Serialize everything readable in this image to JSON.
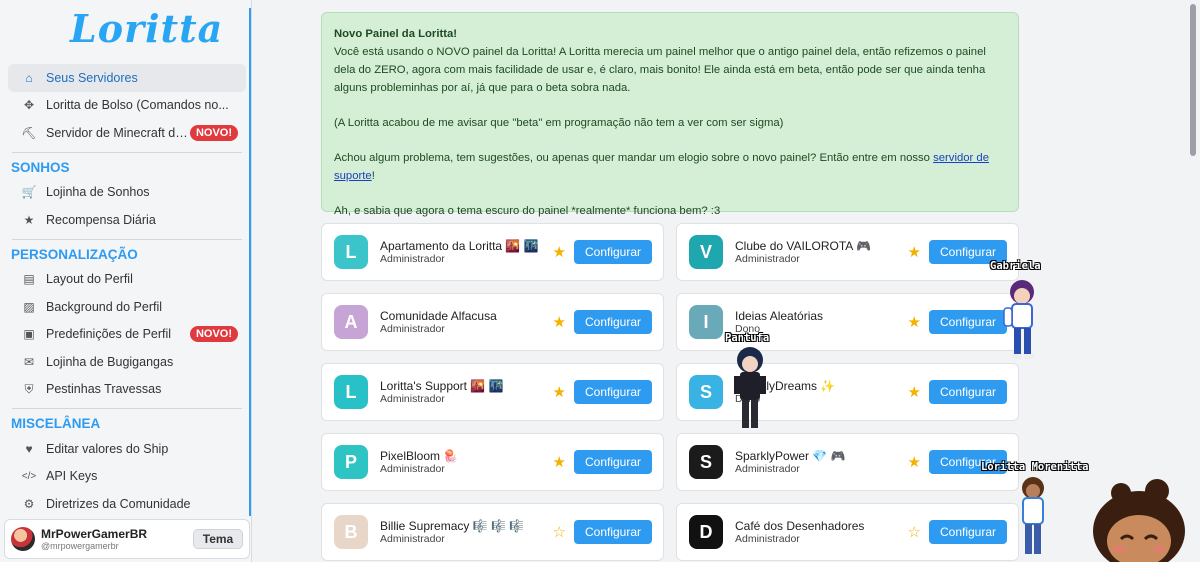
{
  "sidebar": {
    "logo": "Loritta",
    "top_items": [
      {
        "label": "Seus Servidores",
        "icon": "home-icon"
      },
      {
        "label": "Loritta de Bolso (Comandos no...",
        "icon": "puzzle-icon"
      },
      {
        "label": "Servidor de Minecraft da...",
        "icon": "pickaxe-icon",
        "badge": "NOVO!"
      }
    ],
    "sections": [
      {
        "title": "SONHOS",
        "items": [
          {
            "label": "Lojinha de Sonhos",
            "icon": "cart-icon"
          },
          {
            "label": "Recompensa Diária",
            "icon": "star-icon"
          }
        ]
      },
      {
        "title": "PERSONALIZAÇÃO",
        "items": [
          {
            "label": "Layout do Perfil",
            "icon": "id-card-icon"
          },
          {
            "label": "Background do Perfil",
            "icon": "image-icon"
          },
          {
            "label": "Predefinições de Perfil",
            "icon": "preset-icon",
            "badge": "NOVO!"
          },
          {
            "label": "Lojinha de Bugigangas",
            "icon": "mail-icon"
          },
          {
            "label": "Pestinhas Travessas",
            "icon": "shield-icon"
          }
        ]
      },
      {
        "title": "MISCELÂNEA",
        "items": [
          {
            "label": "Editar valores do Ship",
            "icon": "heart-icon"
          },
          {
            "label": "API Keys",
            "icon": "code-icon"
          },
          {
            "label": "Diretrizes da Comunidade",
            "icon": "policy-icon"
          }
        ]
      }
    ],
    "user": {
      "name": "MrPowerGamerBR",
      "handle": "@mrpowergamerbr",
      "theme_button": "Tema"
    }
  },
  "notice": {
    "title": "Novo Painel da Loritta!",
    "p1": "Você está usando o NOVO painel da Loritta! A Loritta merecia um painel melhor que o antigo painel dela, então refizemos o painel dela do ZERO, agora com mais facilidade de usar e, é claro, mais bonito! Ele ainda está em beta, então pode ser que ainda tenha alguns probleminhas por aí, já que para o beta sobra nada.",
    "p2": "(A Loritta acabou de me avisar que \"beta\" em programação não tem a ver com ser sigma)",
    "p3_before": "Achou algum problema, tem sugestões, ou apenas quer mandar um elogio sobre o novo painel? Então entre em nosso ",
    "p3_link": "servidor de suporte",
    "p3_after": "!",
    "p4": "Ah, e sabia que agora o tema escuro do painel *realmente* funciona bem? :3"
  },
  "configure_label": "Configurar",
  "servers": [
    {
      "name": "Apartamento da Loritta 🌇 🌃",
      "role": "Administrador",
      "favorite": true,
      "icon_color": "#3bc4c9",
      "initial": "L"
    },
    {
      "name": "Clube do VAILOROTA 🎮",
      "role": "Administrador",
      "favorite": true,
      "icon_color": "#1fa7b0",
      "initial": "V"
    },
    {
      "name": "Comunidade Alfacusa",
      "role": "Administrador",
      "favorite": true,
      "icon_color": "#c6a4d6",
      "initial": "A"
    },
    {
      "name": "Ideias Aleatórias",
      "role": "Dono",
      "favorite": true,
      "icon_color": "#6aa9b8",
      "initial": "I"
    },
    {
      "name": "Loritta's Support 🌇 🌃",
      "role": "Administrador",
      "favorite": true,
      "icon_color": "#29c1c8",
      "initial": "L"
    },
    {
      "name": "SparklyDreams ✨",
      "role": "Dono",
      "favorite": true,
      "icon_color": "#39b3e3",
      "initial": "S"
    },
    {
      "name": "PixelBloom 🪼",
      "role": "Administrador",
      "favorite": true,
      "icon_color": "#2fc4c4",
      "initial": "P"
    },
    {
      "name": "SparklyPower 💎 🎮",
      "role": "Administrador",
      "favorite": true,
      "icon_color": "#1b1b1b",
      "initial": "S"
    },
    {
      "name": "Billie Supremacy 🎼 🎼 🎼",
      "role": "Administrador",
      "favorite": false,
      "icon_color": "#e8d6c8",
      "initial": "B"
    },
    {
      "name": "Café dos Desenhadores",
      "role": "Administrador",
      "favorite": false,
      "icon_color": "#111111",
      "initial": "D"
    }
  ],
  "characters": {
    "gabriela": "Gabriela",
    "pantufa": "Pantufa",
    "loritta_morenitta": "Loritta Morenitta"
  },
  "colors": {
    "accent": "#2e9bf0",
    "badge": "#e03a3e",
    "notice_bg": "#d5efd6",
    "star": "#f5b100"
  }
}
